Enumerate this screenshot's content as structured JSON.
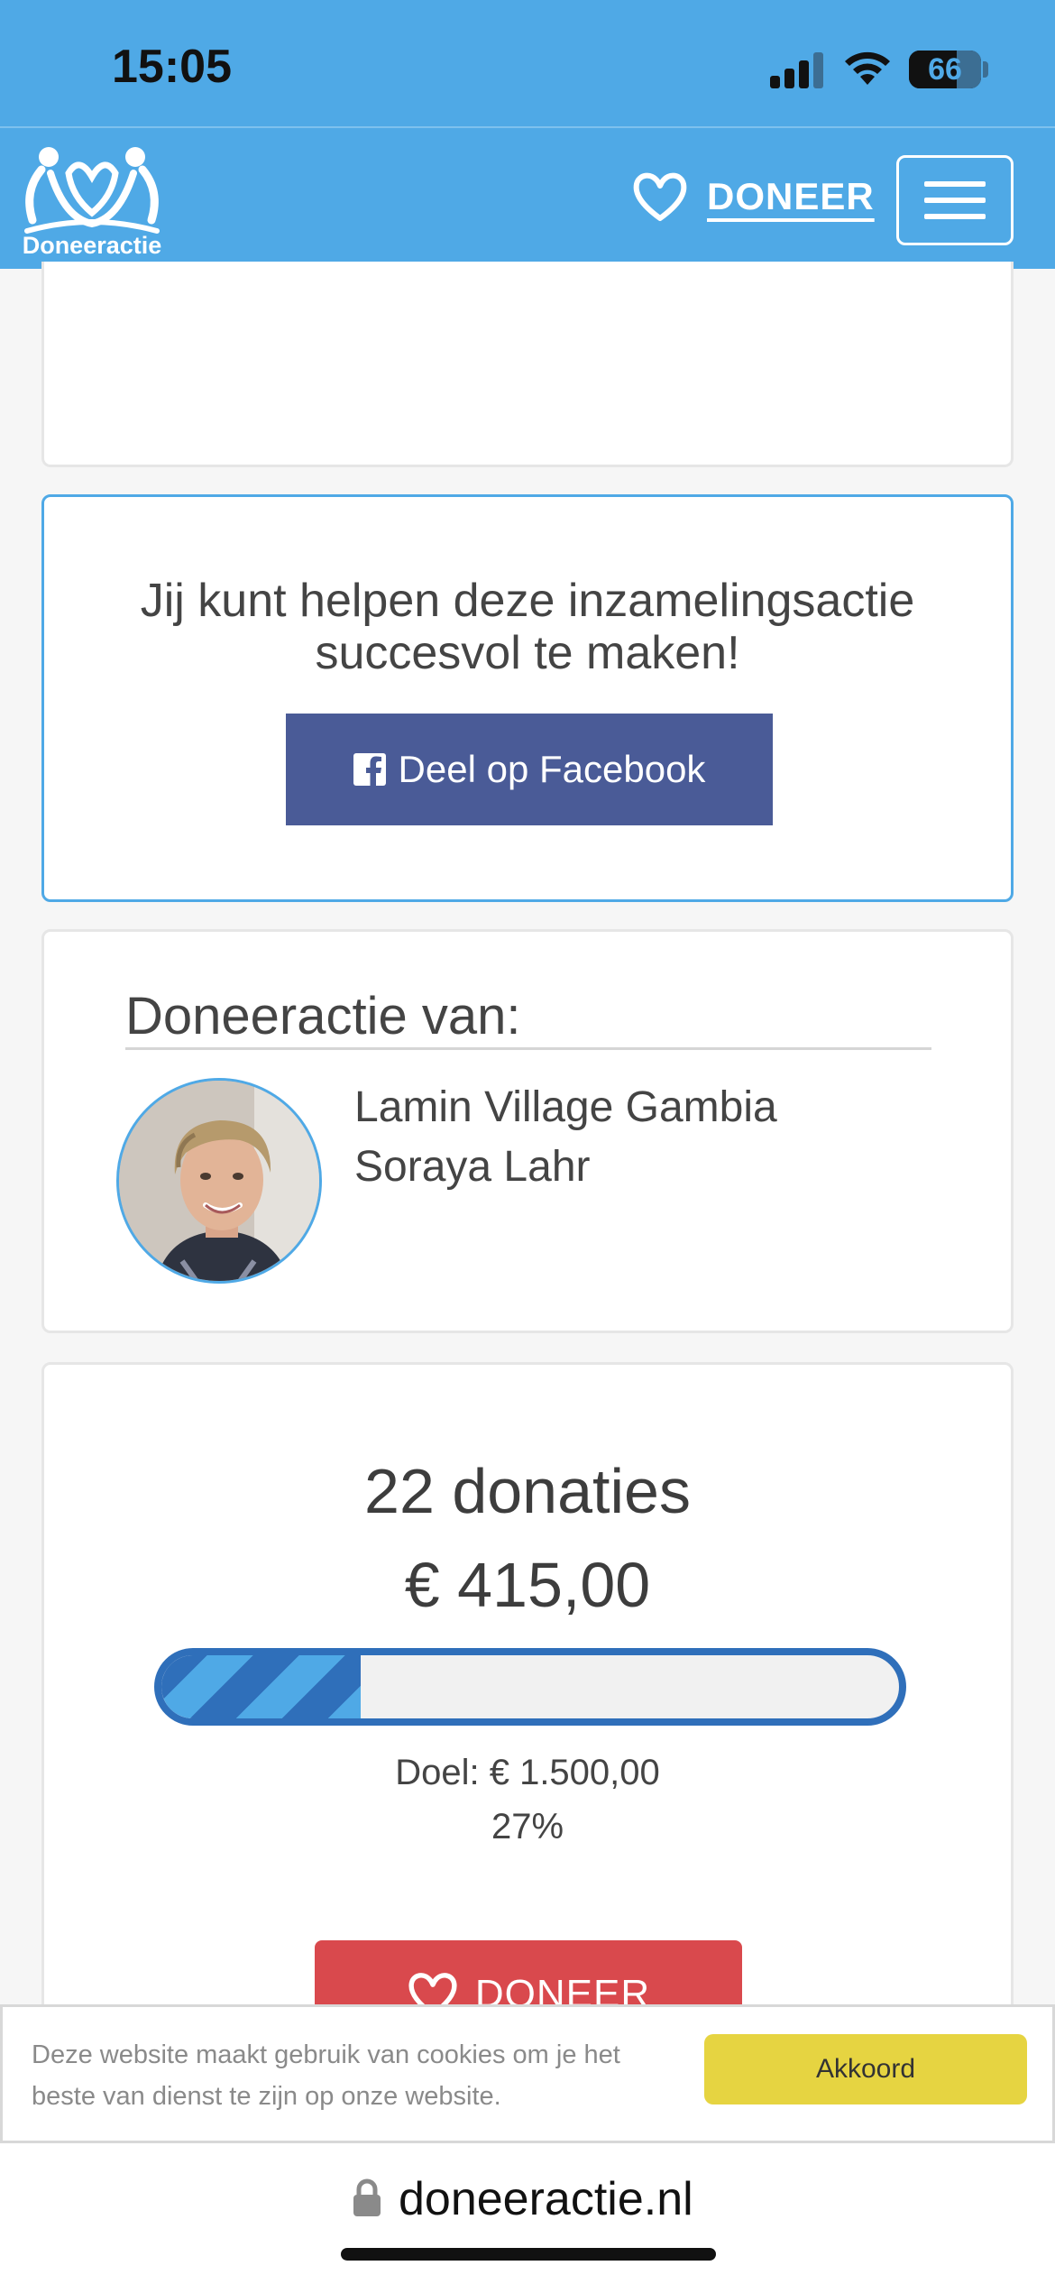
{
  "status_bar": {
    "time": "15:05",
    "battery_level": "66",
    "battery_fraction": 0.66,
    "icons": [
      "signal-icon",
      "wifi-icon",
      "battery-icon"
    ]
  },
  "navbar": {
    "logo_text": "Doneeractie",
    "donate_label": "DONEER",
    "menu_icon": "hamburger-icon",
    "accent_color": "#4fa9e6"
  },
  "share": {
    "title": "Jij kunt helpen deze inzamelingsactie succesvol te maken!",
    "facebook_label": "Deel op Facebook",
    "facebook_color": "#4a5b97"
  },
  "owner": {
    "heading": "Doneeractie van:",
    "organization": "Lamin Village Gambia",
    "person": "Soraya Lahr"
  },
  "stats": {
    "donations": "22 donaties",
    "amount": "€ 415,00",
    "goal": "Doel: € 1.500,00",
    "percent": "27%",
    "progress_fraction": 0.27,
    "donate_label": "DONEER",
    "donate_color": "#d9494d"
  },
  "cookie": {
    "message": "Deze website maakt gebruik van cookies om je het beste van dienst te zijn op onze website.",
    "accept_label": "Akkoord",
    "accept_color": "#e6d441"
  },
  "browser": {
    "url": "doneeractie.nl"
  }
}
